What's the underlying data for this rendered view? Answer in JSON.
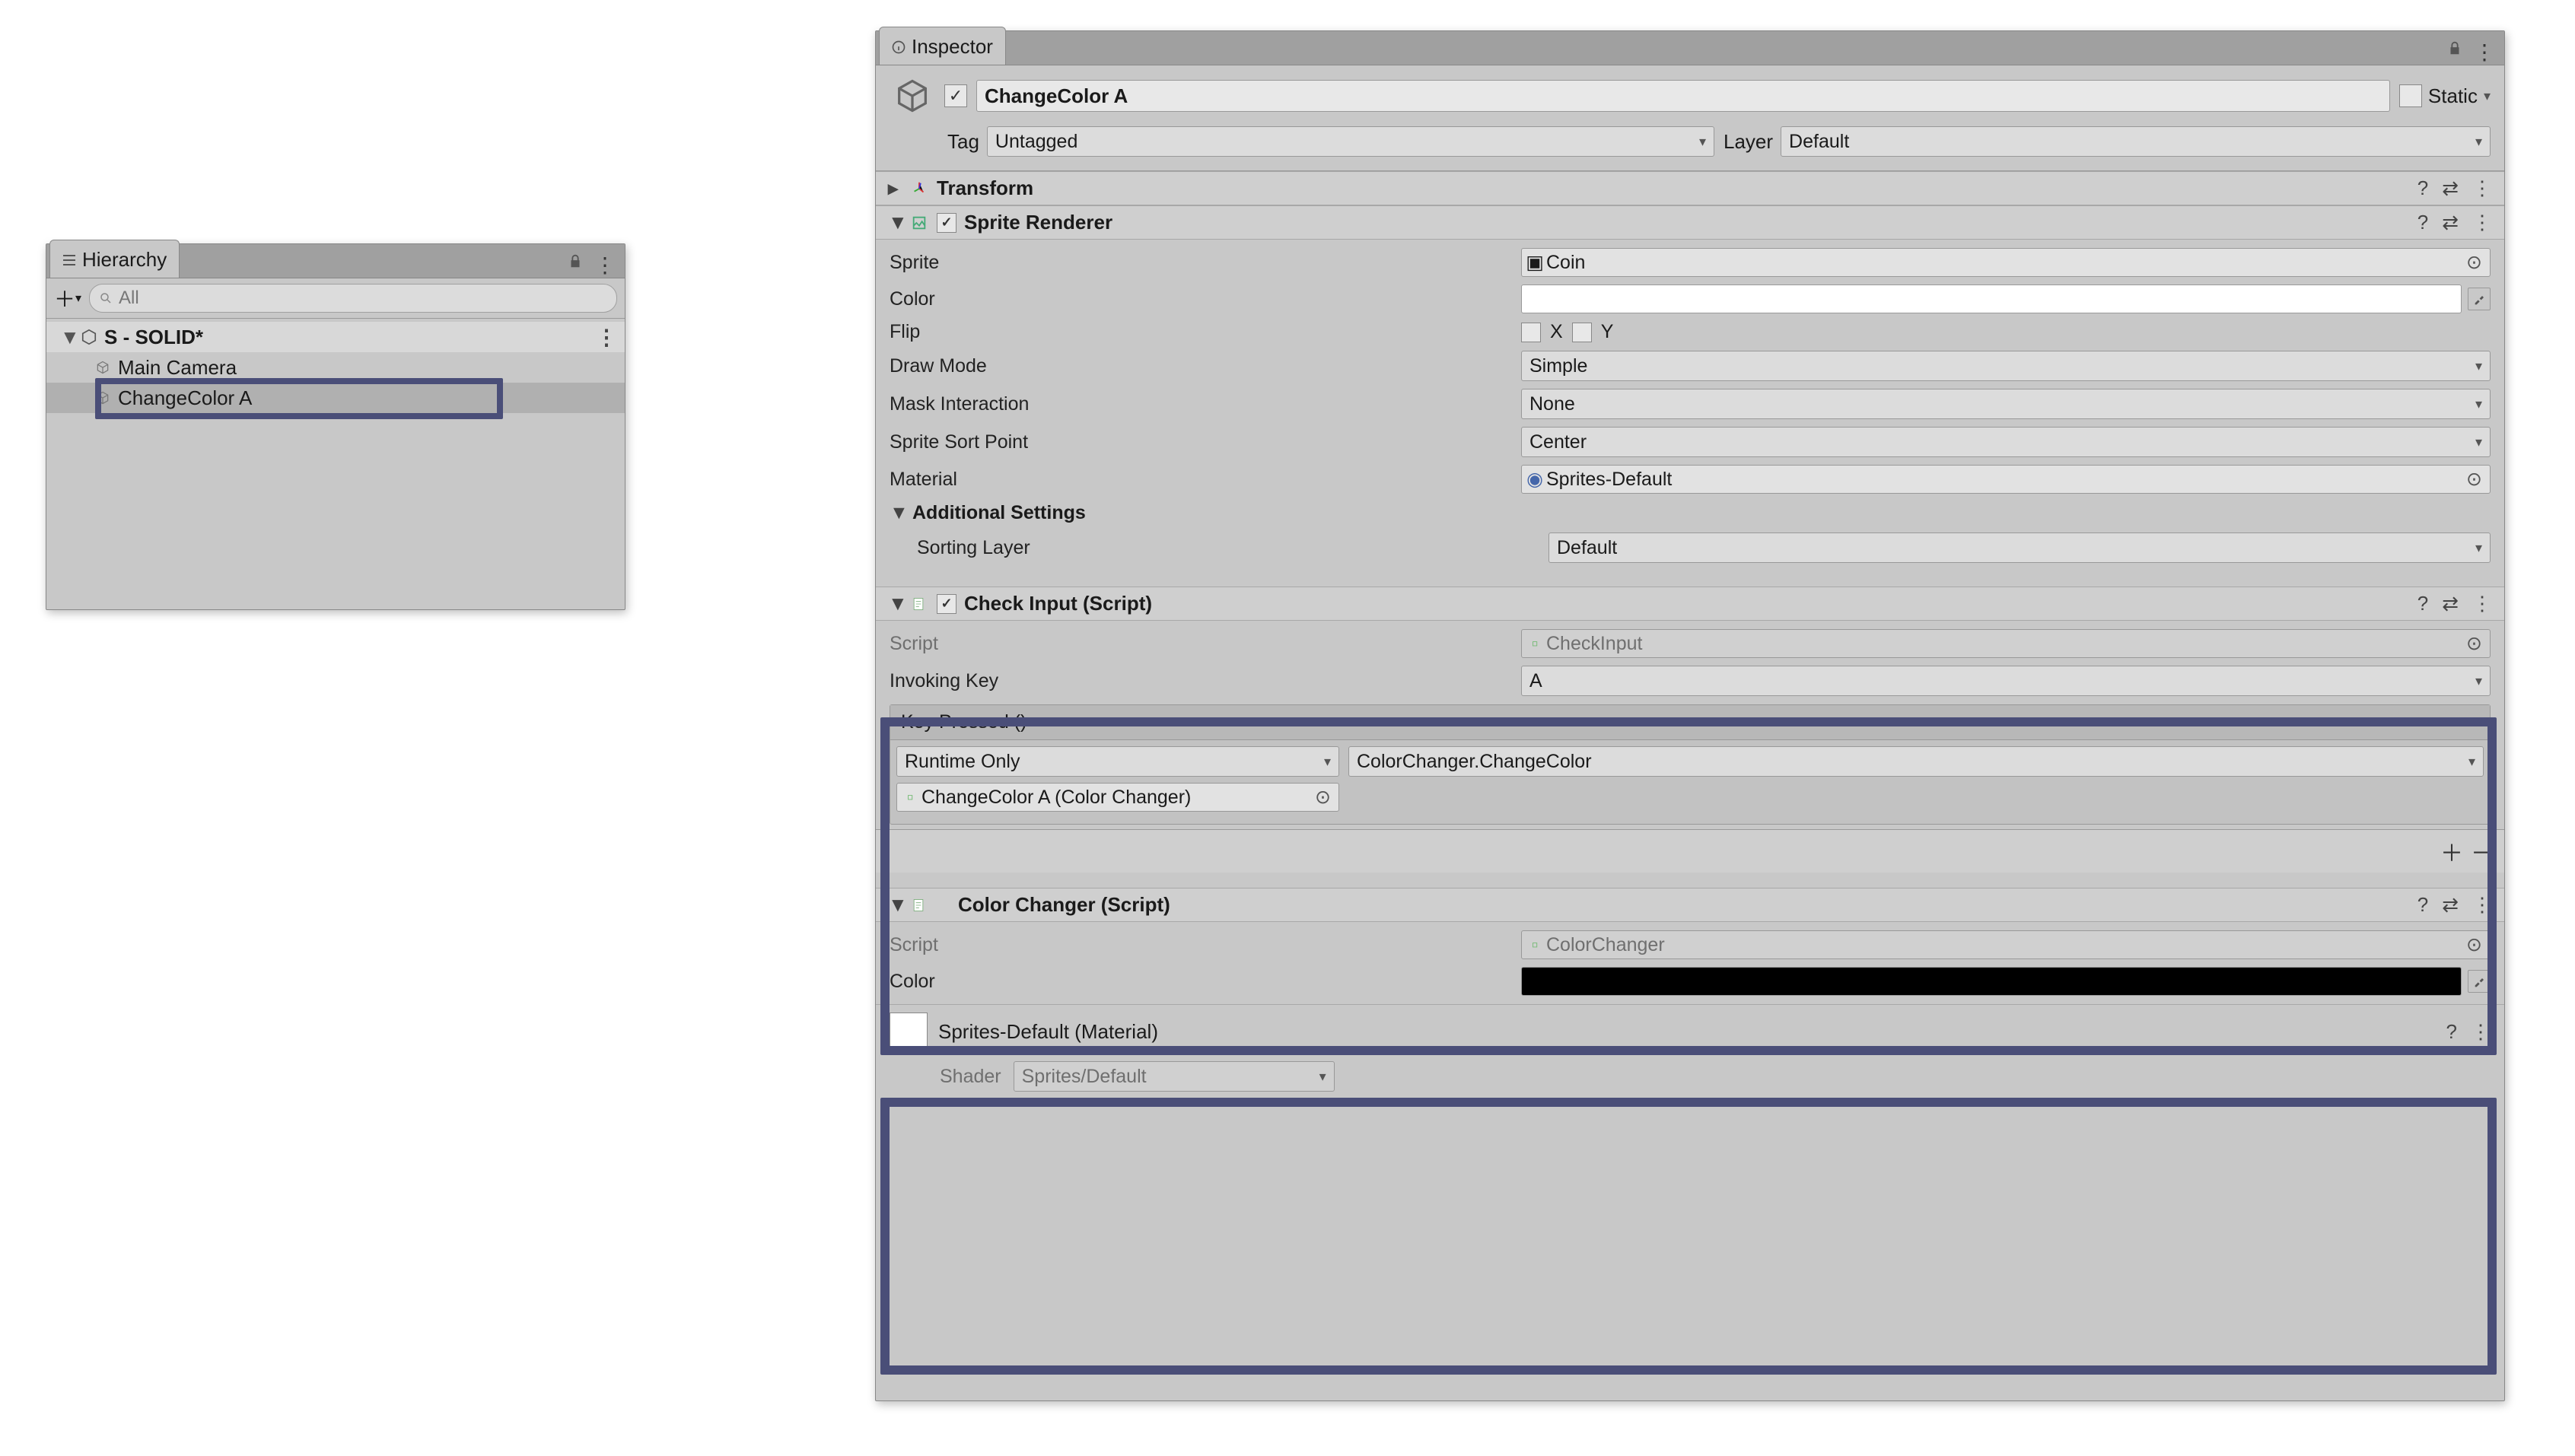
{
  "hierarchy": {
    "tab_title": "Hierarchy",
    "search_placeholder": "All",
    "scene_name": "S - SOLID*",
    "items": [
      {
        "label": "Main Camera"
      },
      {
        "label": "ChangeColor A"
      }
    ]
  },
  "inspector": {
    "tab_title": "Inspector",
    "gameobject": {
      "active_checked": "✓",
      "name": "ChangeColor A",
      "static_label": "Static",
      "tag_label": "Tag",
      "tag_value": "Untagged",
      "layer_label": "Layer",
      "layer_value": "Default"
    },
    "transform": {
      "title": "Transform"
    },
    "sprite_renderer": {
      "title": "Sprite Renderer",
      "props": {
        "sprite_label": "Sprite",
        "sprite_value": "Coin",
        "color_label": "Color",
        "flip_label": "Flip",
        "flip_x": "X",
        "flip_y": "Y",
        "draw_mode_label": "Draw Mode",
        "draw_mode_value": "Simple",
        "mask_label": "Mask Interaction",
        "mask_value": "None",
        "sort_point_label": "Sprite Sort Point",
        "sort_point_value": "Center",
        "material_label": "Material",
        "material_value": "Sprites-Default",
        "additional_label": "Additional Settings",
        "sorting_layer_label": "Sorting Layer",
        "sorting_layer_value": "Default"
      }
    },
    "check_input": {
      "title": "Check Input (Script)",
      "script_label": "Script",
      "script_value": "CheckInput",
      "invoking_key_label": "Invoking Key",
      "invoking_key_value": "A",
      "event_title": "Key Pressed ()",
      "runtime_value": "Runtime Only",
      "function_value": "ColorChanger.ChangeColor",
      "target_value": "ChangeColor A (Color Changer)"
    },
    "color_changer": {
      "title": "Color Changer (Script)",
      "script_label": "Script",
      "script_value": "ColorChanger",
      "color_label": "Color"
    },
    "material": {
      "title": "Sprites-Default (Material)",
      "shader_label": "Shader",
      "shader_value": "Sprites/Default"
    }
  }
}
